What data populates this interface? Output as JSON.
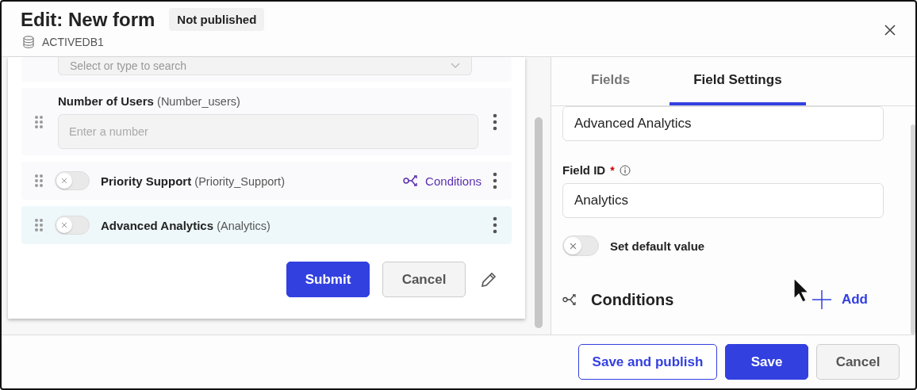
{
  "header": {
    "title": "Edit: New form",
    "status_badge": "Not published",
    "database": "ACTIVEDB1"
  },
  "form": {
    "fields": [
      {
        "kind": "select",
        "placeholder": "Select or type to search",
        "selected": false
      },
      {
        "kind": "number",
        "label": "Number of Users",
        "field_id": "(Number_users)",
        "placeholder": "Enter a number",
        "selected": false
      },
      {
        "kind": "toggle",
        "label": "Priority Support",
        "field_id": "(Priority_Support)",
        "on": false,
        "conditions_link": "Conditions",
        "selected": false
      },
      {
        "kind": "toggle",
        "label": "Advanced Analytics",
        "field_id": "(Analytics)",
        "on": false,
        "selected": true
      }
    ],
    "buttons": [
      {
        "label": "Submit",
        "kind": "primary"
      },
      {
        "label": "Cancel",
        "kind": "secondary"
      }
    ]
  },
  "settings": {
    "tabs": [
      {
        "label": "Fields",
        "selected": false
      },
      {
        "label": "Field Settings",
        "selected": true
      }
    ],
    "label_value": "Advanced Analytics",
    "field_id_label": "Field ID",
    "required_mark": "*",
    "field_id_value": "Analytics",
    "default_toggle": {
      "label": "Set default value",
      "on": false
    },
    "conditions_heading": "Conditions",
    "add_button": "Add"
  },
  "footer": {
    "buttons": [
      {
        "label": "Save and publish",
        "kind": "outline"
      },
      {
        "label": "Save",
        "kind": "primary"
      },
      {
        "label": "Cancel",
        "kind": "secondary"
      }
    ]
  }
}
